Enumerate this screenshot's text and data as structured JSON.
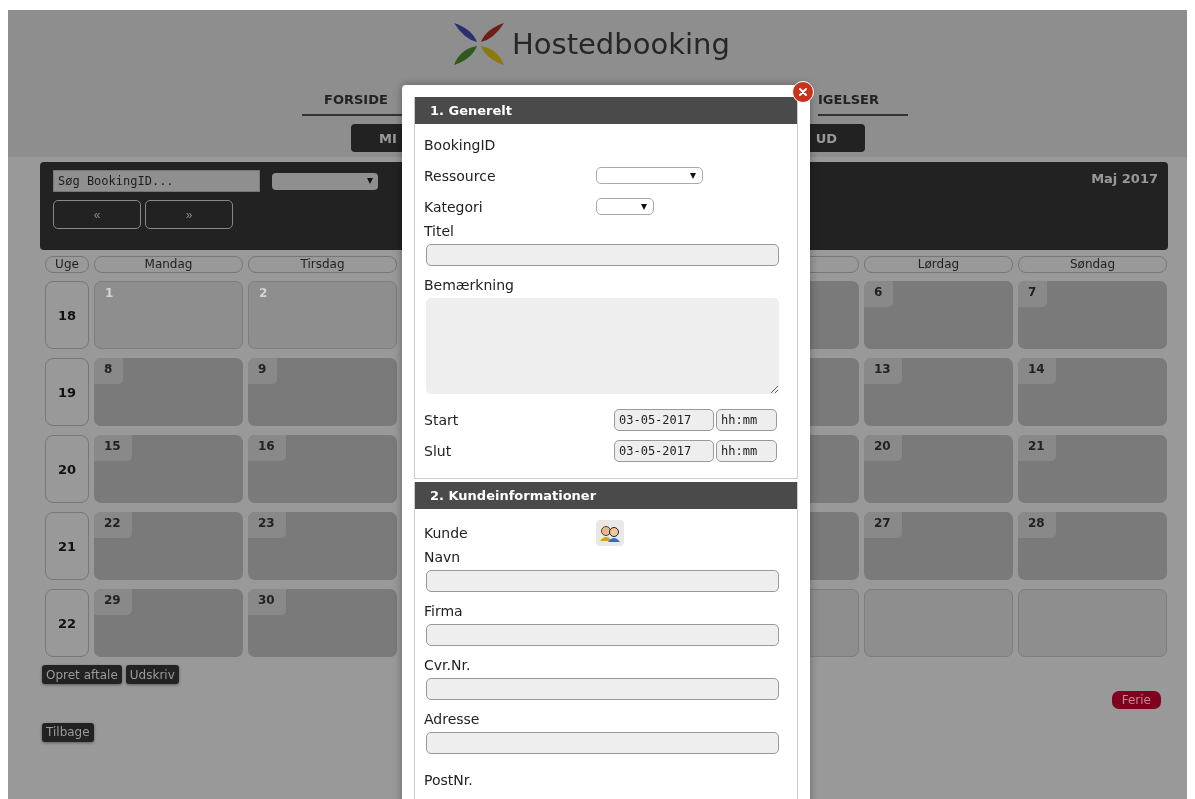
{
  "brand": {
    "name": "Hostedbooking"
  },
  "nav": [
    {
      "label": "FORSIDE"
    },
    {
      "label": "IGELSER"
    }
  ],
  "subnav": [
    {
      "label": "MI"
    },
    {
      "label": "UD"
    }
  ],
  "toolbar": {
    "search": {
      "placeholder": "Søg BookingID..."
    },
    "prev": "«",
    "next": "»",
    "month": "Maj 2017"
  },
  "calendar": {
    "week_heading": "Uge",
    "days_of_week": {
      "monday": "Mandag",
      "tuesday": "Tirsdag",
      "saturday": "Lørdag",
      "sunday": "Søndag"
    },
    "weeks": [
      {
        "number": "18",
        "days": [
          {
            "kind": "past",
            "day": "1"
          },
          {
            "kind": "past",
            "day": "2"
          },
          {
            "kind": "day"
          },
          {
            "kind": "day"
          },
          {
            "kind": "day"
          },
          {
            "kind": "day",
            "day": "6"
          },
          {
            "kind": "day",
            "day": "7"
          }
        ]
      },
      {
        "number": "19",
        "days": [
          {
            "kind": "day",
            "day": "8"
          },
          {
            "kind": "day",
            "day": "9"
          },
          {
            "kind": "day"
          },
          {
            "kind": "day"
          },
          {
            "kind": "day"
          },
          {
            "kind": "day",
            "day": "13"
          },
          {
            "kind": "day",
            "day": "14"
          }
        ]
      },
      {
        "number": "20",
        "days": [
          {
            "kind": "day",
            "day": "15"
          },
          {
            "kind": "day",
            "day": "16"
          },
          {
            "kind": "day"
          },
          {
            "kind": "day"
          },
          {
            "kind": "day"
          },
          {
            "kind": "day",
            "day": "20"
          },
          {
            "kind": "day",
            "day": "21"
          }
        ]
      },
      {
        "number": "21",
        "days": [
          {
            "kind": "day",
            "day": "22"
          },
          {
            "kind": "day",
            "day": "23"
          },
          {
            "kind": "day"
          },
          {
            "kind": "day"
          },
          {
            "kind": "day"
          },
          {
            "kind": "day",
            "day": "27"
          },
          {
            "kind": "day",
            "day": "28"
          }
        ]
      },
      {
        "number": "22",
        "days": [
          {
            "kind": "day",
            "day": "29"
          },
          {
            "kind": "day",
            "day": "30"
          },
          {
            "kind": "day"
          },
          {
            "kind": "empty"
          },
          {
            "kind": "empty"
          },
          {
            "kind": "empty"
          },
          {
            "kind": "empty"
          }
        ]
      }
    ]
  },
  "actions": [
    "Opret aftale",
    "Udskriv"
  ],
  "back": "Tilbage",
  "legend": [
    {
      "label": "Ferie",
      "color": "#800020"
    }
  ],
  "modal": {
    "sections": [
      {
        "title": "1. Generelt",
        "fields": [
          {
            "kind": "plain",
            "label": "BookingID"
          },
          {
            "kind": "select",
            "label": "Ressource"
          },
          {
            "kind": "select",
            "label": "Kategori"
          },
          {
            "kind": "input",
            "label": "Titel"
          },
          {
            "kind": "textarea",
            "label": "Bemærkning"
          },
          {
            "kind": "datetime",
            "label": "Start",
            "date": "03-05-2017",
            "time": "hh:mm"
          },
          {
            "kind": "datetime",
            "label": "Slut",
            "date": "03-05-2017",
            "time": "hh:mm"
          }
        ]
      },
      {
        "title": "2. Kundeinformationer",
        "fields": [
          {
            "kind": "customer",
            "label": "Kunde"
          },
          {
            "kind": "input",
            "label": "Navn"
          },
          {
            "kind": "input",
            "label": "Firma"
          },
          {
            "kind": "input",
            "label": "Cvr.Nr."
          },
          {
            "kind": "input",
            "label": "Adresse"
          },
          {
            "kind": "plain",
            "label": "PostNr."
          }
        ]
      }
    ]
  }
}
